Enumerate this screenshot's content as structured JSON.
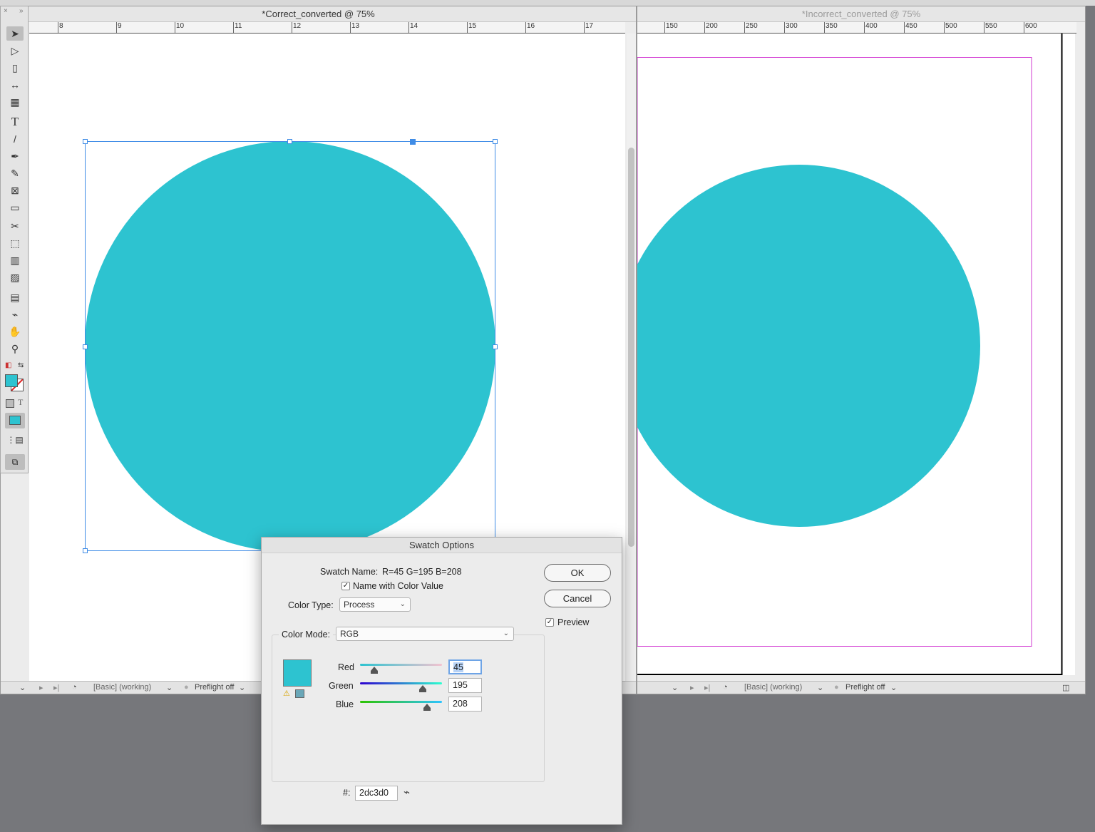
{
  "colors": {
    "swatch": "#2dc3d0",
    "selection": "#3f8ce6",
    "margin_guide": "#d23ad2"
  },
  "left_window": {
    "title": "*Correct_converted @ 75%",
    "ruler_labels": [
      "8",
      "9",
      "10",
      "11",
      "12",
      "13",
      "14",
      "15",
      "16",
      "17"
    ],
    "status": {
      "workspace": "[Basic] (working)",
      "preflight": "Preflight off"
    }
  },
  "right_window": {
    "title": "*Incorrect_converted @ 75%",
    "ruler_labels": [
      "150",
      "200",
      "250",
      "300",
      "350",
      "400",
      "450",
      "500",
      "550",
      "600"
    ],
    "status": {
      "workspace": "[Basic] (working)",
      "preflight": "Preflight off"
    }
  },
  "toolbox": {
    "tools": [
      {
        "name": "selection-tool",
        "glyph": "➤"
      },
      {
        "name": "direct-selection-tool",
        "glyph": "▷"
      },
      {
        "name": "page-tool",
        "glyph": "▯"
      },
      {
        "name": "gap-tool",
        "glyph": "↔"
      },
      {
        "name": "content-collector-tool",
        "glyph": "▦"
      },
      {
        "name": "type-tool",
        "glyph": "T"
      },
      {
        "name": "line-tool",
        "glyph": "/"
      },
      {
        "name": "pen-tool",
        "glyph": "✒"
      },
      {
        "name": "pencil-tool",
        "glyph": "✎"
      },
      {
        "name": "rectangle-frame-tool",
        "glyph": "⊠"
      },
      {
        "name": "rectangle-tool",
        "glyph": "▭"
      },
      {
        "name": "scissors-tool",
        "glyph": "✂"
      },
      {
        "name": "free-transform-tool",
        "glyph": "⬚"
      },
      {
        "name": "gradient-swatch-tool",
        "glyph": "▥"
      },
      {
        "name": "gradient-feather-tool",
        "glyph": "▨"
      },
      {
        "name": "note-tool",
        "glyph": "▤"
      },
      {
        "name": "eyedropper-tool",
        "glyph": "⌁"
      },
      {
        "name": "hand-tool",
        "glyph": "✋"
      },
      {
        "name": "zoom-tool",
        "glyph": "⚲"
      }
    ]
  },
  "dialog": {
    "title": "Swatch Options",
    "swatch_name_label": "Swatch Name:",
    "swatch_name_value": "R=45 G=195 B=208",
    "name_with_color_value_label": "Name with Color Value",
    "name_with_color_value_checked": true,
    "color_type_label": "Color Type:",
    "color_type_value": "Process",
    "color_mode_label": "Color Mode:",
    "color_mode_value": "RGB",
    "ok_label": "OK",
    "cancel_label": "Cancel",
    "preview_label": "Preview",
    "preview_checked": true,
    "channels": [
      {
        "label": "Red",
        "value": "45",
        "fraction": 0.176
      },
      {
        "label": "Green",
        "value": "195",
        "fraction": 0.765
      },
      {
        "label": "Blue",
        "value": "208",
        "fraction": 0.816
      }
    ],
    "hex_label": "#:",
    "hex_value": "2dc3d0"
  }
}
